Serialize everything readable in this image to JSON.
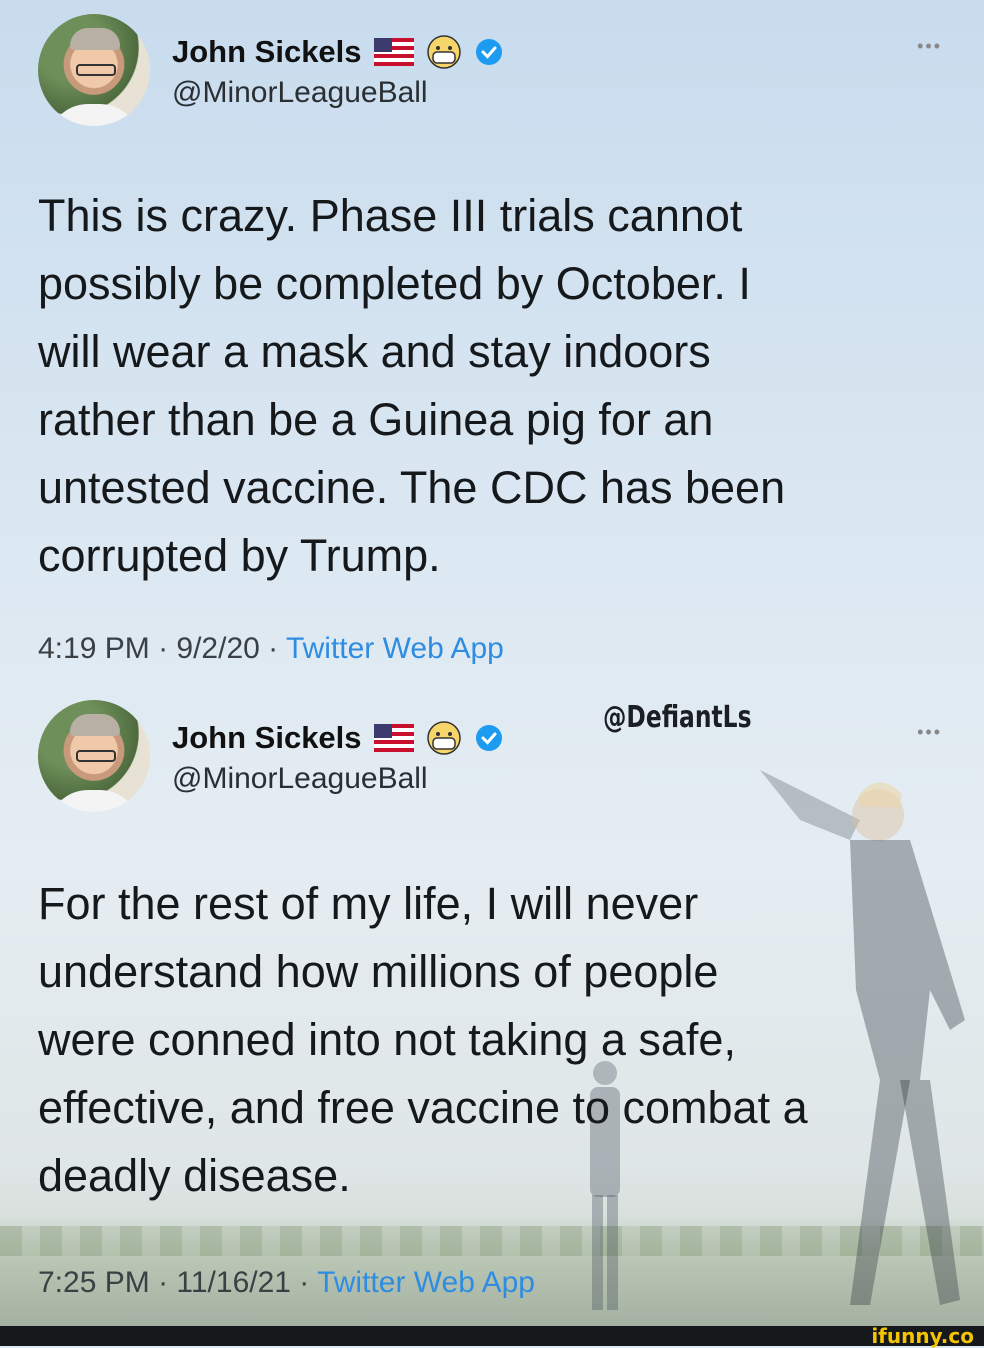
{
  "tweets": [
    {
      "name": "John Sickels",
      "handle": "@MinorLeagueBall",
      "text": "This is crazy. Phase III trials cannot\npossibly be completed by October. I\nwill wear a mask and stay indoors\nrather than be a Guinea pig for an\nuntested vaccine. The CDC has been\ncorrupted by Trump.",
      "time": "4:19 PM",
      "date": "9/2/20",
      "app": "Twitter Web App",
      "more": "•••"
    },
    {
      "name": "John Sickels",
      "handle": "@MinorLeagueBall",
      "text": "For the rest of my life, I will never\nunderstand how millions of people\nwere conned into not taking a safe,\neffective, and free vaccine to combat a\ndeadly disease.",
      "time": "7:25 PM",
      "date": "11/16/21",
      "app": "Twitter Web App",
      "more": "•••"
    }
  ],
  "separator": " · ",
  "overlay_credit": "@DefiantLs",
  "footer": {
    "watermark": "ifunny.co"
  },
  "icons": [
    "us-flag-icon",
    "face-with-mask-icon",
    "verified-badge-icon"
  ],
  "colors": {
    "link": "#2e8de0",
    "verified": "#1d9bf0"
  }
}
